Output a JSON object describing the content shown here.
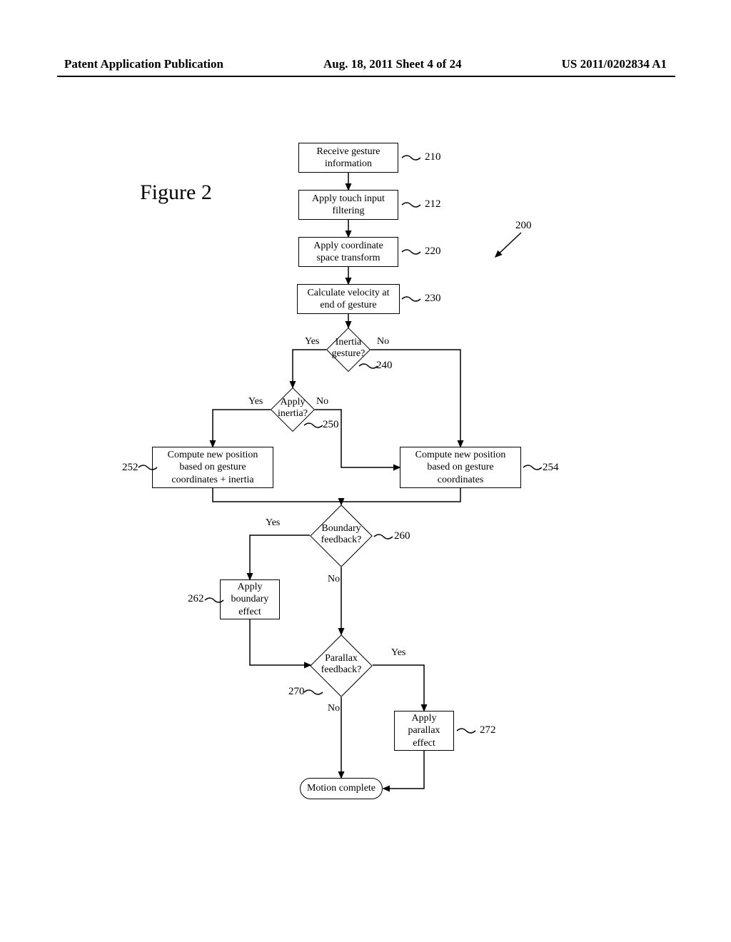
{
  "header": {
    "left": "Patent Application Publication",
    "center": "Aug. 18, 2011  Sheet 4 of 24",
    "right": "US 2011/0202834 A1"
  },
  "figure_label": "Figure 2",
  "ref_200": "200",
  "boxes": {
    "b210": "Receive gesture information",
    "b212": "Apply touch input filtering",
    "b220": "Apply coordinate space transform",
    "b230": "Calculate velocity at end of gesture",
    "b252": "Compute new position based on gesture coordinates + inertia",
    "b254": "Compute new position based on gesture coordinates",
    "b262": "Apply boundary effect",
    "b272": "Apply parallax effect"
  },
  "diamonds": {
    "d240": "Inertia gesture?",
    "d250": "Apply inertia?",
    "d260": "Boundary feedback?",
    "d270": "Parallax feedback?"
  },
  "nums": {
    "n210": "210",
    "n212": "212",
    "n220": "220",
    "n230": "230",
    "n240": "240",
    "n250": "250",
    "n252": "252",
    "n254": "254",
    "n260": "260",
    "n262": "262",
    "n270": "270",
    "n272": "272"
  },
  "labels": {
    "yes": "Yes",
    "no": "No"
  },
  "terminal": "Motion complete",
  "chart_data": {
    "type": "flowchart",
    "title": "Figure 2",
    "nodes": [
      {
        "id": "210",
        "type": "process",
        "text": "Receive gesture information"
      },
      {
        "id": "212",
        "type": "process",
        "text": "Apply touch input filtering"
      },
      {
        "id": "220",
        "type": "process",
        "text": "Apply coordinate space transform"
      },
      {
        "id": "230",
        "type": "process",
        "text": "Calculate velocity at end of gesture"
      },
      {
        "id": "240",
        "type": "decision",
        "text": "Inertia gesture?"
      },
      {
        "id": "250",
        "type": "decision",
        "text": "Apply inertia?"
      },
      {
        "id": "252",
        "type": "process",
        "text": "Compute new position based on gesture coordinates + inertia"
      },
      {
        "id": "254",
        "type": "process",
        "text": "Compute new position based on gesture coordinates"
      },
      {
        "id": "260",
        "type": "decision",
        "text": "Boundary feedback?"
      },
      {
        "id": "262",
        "type": "process",
        "text": "Apply boundary effect"
      },
      {
        "id": "270",
        "type": "decision",
        "text": "Parallax feedback?"
      },
      {
        "id": "272",
        "type": "process",
        "text": "Apply parallax effect"
      },
      {
        "id": "end",
        "type": "terminal",
        "text": "Motion complete"
      }
    ],
    "edges": [
      {
        "from": "210",
        "to": "212"
      },
      {
        "from": "212",
        "to": "220"
      },
      {
        "from": "220",
        "to": "230"
      },
      {
        "from": "230",
        "to": "240"
      },
      {
        "from": "240",
        "to": "250",
        "label": "Yes"
      },
      {
        "from": "240",
        "to": "254",
        "label": "No"
      },
      {
        "from": "250",
        "to": "252",
        "label": "Yes"
      },
      {
        "from": "250",
        "to": "254",
        "label": "No"
      },
      {
        "from": "252",
        "to": "260"
      },
      {
        "from": "254",
        "to": "260"
      },
      {
        "from": "260",
        "to": "262",
        "label": "Yes"
      },
      {
        "from": "260",
        "to": "270",
        "label": "No"
      },
      {
        "from": "262",
        "to": "270"
      },
      {
        "from": "270",
        "to": "272",
        "label": "Yes"
      },
      {
        "from": "270",
        "to": "end",
        "label": "No"
      },
      {
        "from": "272",
        "to": "end"
      }
    ],
    "overall_ref": "200"
  }
}
